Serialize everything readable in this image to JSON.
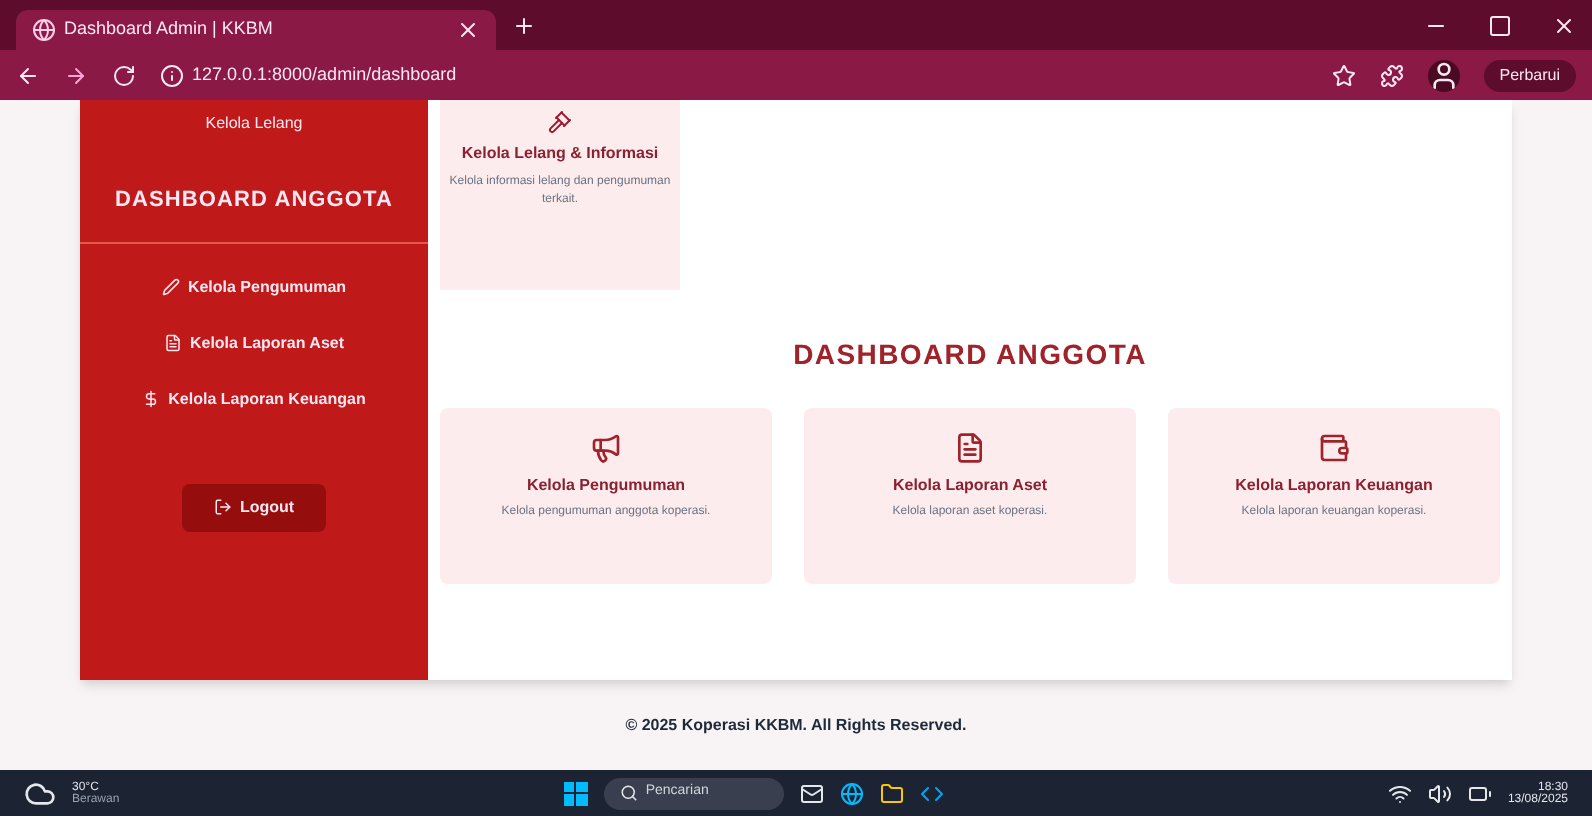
{
  "browser": {
    "tab_title": "Dashboard Admin | KKBM",
    "url": "127.0.0.1:8000/admin/dashboard",
    "update_button": "Perbarui"
  },
  "sidebar": {
    "top_item": "Kelola Lelang",
    "title": "DASHBOARD ANGGOTA",
    "items": [
      {
        "label": "Kelola Pengumuman"
      },
      {
        "label": "Kelola Laporan Aset"
      },
      {
        "label": "Kelola Laporan Keuangan"
      }
    ],
    "logout": "Logout"
  },
  "top_card": {
    "title": "Kelola Lelang & Informasi",
    "description": "Kelola informasi lelang dan pengumuman terkait."
  },
  "heading": "DASHBOARD ANGGOTA",
  "cards": [
    {
      "title": "Kelola Pengumuman",
      "description": "Kelola pengumuman anggota koperasi."
    },
    {
      "title": "Kelola Laporan Aset",
      "description": "Kelola laporan aset koperasi."
    },
    {
      "title": "Kelola Laporan Keuangan",
      "description": "Kelola laporan keuangan koperasi."
    }
  ],
  "footer": "© 2025 Koperasi KKBM. All Rights Reserved.",
  "taskbar": {
    "weather": "30°C",
    "weather_note": "Berawan",
    "search": "Pencarian",
    "time": "18:30",
    "date": "13/08/2025"
  }
}
